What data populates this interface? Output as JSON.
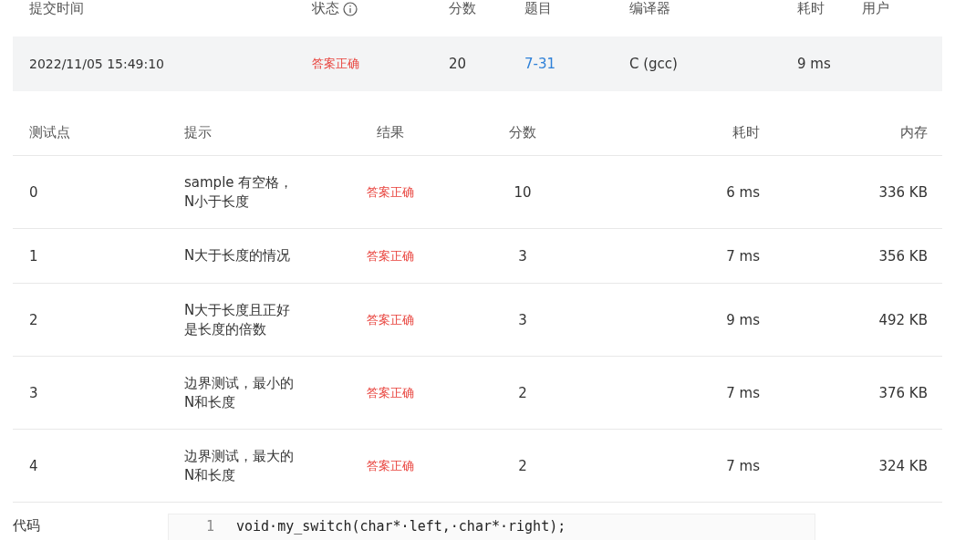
{
  "submission": {
    "columns": [
      {
        "label": "提交时间"
      },
      {
        "label": "状态",
        "info": true
      },
      {
        "label": "分数"
      },
      {
        "label": "题目"
      },
      {
        "label": "编译器"
      },
      {
        "label": "耗时"
      },
      {
        "label": "用户"
      }
    ],
    "row": {
      "time": "2022/11/05 15:49:10",
      "status": {
        "kind": "accepted",
        "text": "答案正确"
      },
      "score": "20",
      "problem": "7-31",
      "compiler": "C (gcc)",
      "duration": "9 ms"
    }
  },
  "tests": {
    "columns": [
      "测试点",
      "提示",
      "结果",
      "分数",
      "耗时",
      "内存"
    ],
    "rows": [
      {
        "id": "0",
        "hint": [
          "sample 有空格，",
          "N小于长度"
        ],
        "result": {
          "kind": "accepted",
          "text": "答案正确"
        },
        "score": "10",
        "duration": "6 ms",
        "memory": "336 KB"
      },
      {
        "id": "1",
        "hint": [
          "N大于长度的情况"
        ],
        "result": {
          "kind": "accepted",
          "text": "答案正确"
        },
        "score": "3",
        "duration": "7 ms",
        "memory": "356 KB"
      },
      {
        "id": "2",
        "hint": [
          "N大于长度且正好",
          "是长度的倍数"
        ],
        "result": {
          "kind": "accepted",
          "text": "答案正确"
        },
        "score": "3",
        "duration": "9 ms",
        "memory": "492 KB"
      },
      {
        "id": "3",
        "hint": [
          "边界测试，最小的",
          "N和长度"
        ],
        "result": {
          "kind": "accepted",
          "text": "答案正确"
        },
        "score": "2",
        "duration": "7 ms",
        "memory": "376 KB"
      },
      {
        "id": "4",
        "hint": [
          "边界测试，最大的",
          "N和长度"
        ],
        "result": {
          "kind": "accepted",
          "text": "答案正确"
        },
        "score": "2",
        "duration": "7 ms",
        "memory": "324 KB"
      }
    ]
  },
  "code": {
    "label": "代码",
    "lines": [
      {
        "number": "1",
        "text": "void·my_switch(char*·left,·char*·right);"
      }
    ]
  }
}
